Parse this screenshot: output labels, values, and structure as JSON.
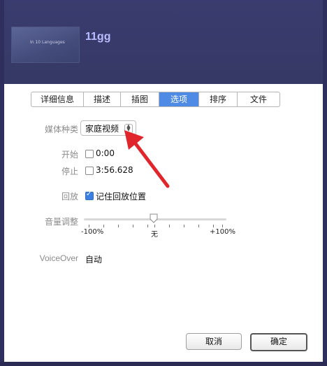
{
  "header": {
    "title": "11gg",
    "thumbnail_text": "In 10 Languages"
  },
  "tabs": [
    {
      "label": "详细信息",
      "active": false
    },
    {
      "label": "描述",
      "active": false
    },
    {
      "label": "插图",
      "active": false
    },
    {
      "label": "选项",
      "active": true
    },
    {
      "label": "排序",
      "active": false
    },
    {
      "label": "文件",
      "active": false
    }
  ],
  "options": {
    "media_kind_label": "媒体种类",
    "media_kind_value": "家庭视频",
    "start_label": "开始",
    "start_value": "0:00",
    "start_checked": false,
    "stop_label": "停止",
    "stop_value": "3:56.628",
    "stop_checked": false,
    "playback_label": "回放",
    "remember_position_label": "记住回放位置",
    "remember_position_checked": true,
    "volume_label": "音量调整",
    "volume_min_label": "-100%",
    "volume_mid_label": "无",
    "volume_max_label": "+100%",
    "volume_value_percent": 0,
    "voiceover_label": "VoiceOver",
    "voiceover_value": "自动"
  },
  "buttons": {
    "cancel": "取消",
    "ok": "确定"
  },
  "colors": {
    "header_bg": "#3a3c6f",
    "title_color": "#b9bcff",
    "active_tab": "#4f8be4",
    "checkbox_checked": "#3b7fe0",
    "annotation_arrow": "#e0262b"
  }
}
